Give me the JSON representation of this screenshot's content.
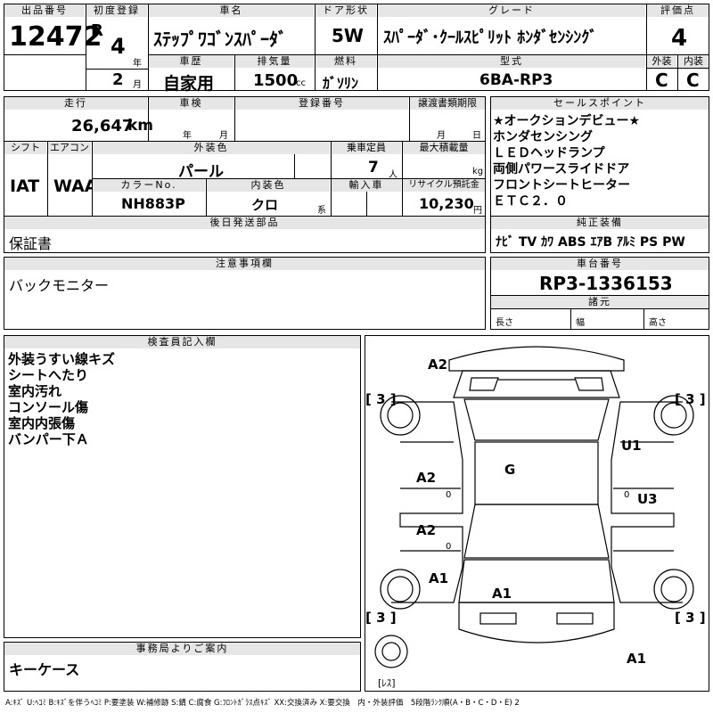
{
  "top": {
    "lot_label": "出品番号",
    "lot_number": "12472",
    "first_reg_label": "初度登録",
    "era": "R",
    "year": "4",
    "year_unit": "年",
    "month": "2",
    "month_unit": "月",
    "name_label": "車名",
    "car_name": "ｽﾃｯﾌﾟﾜｺﾞﾝｽﾊﾟｰﾀﾞ",
    "door_label": "ドア形状",
    "door_value": "5W",
    "grade_label": "グレード",
    "grade_value": "ｽﾊﾟｰﾀﾞ･ｸｰﾙｽﾋﾟﾘｯﾄ ﾎﾝﾀﾞｾﾝｼﾝｸﾞ",
    "score_label": "評価点",
    "score_value": "4",
    "history_label": "車歴",
    "history_value": "自家用",
    "displacement_label": "排気量",
    "displacement_value": "1500",
    "displacement_unit": "cc",
    "fuel_label": "燃料",
    "fuel_value": "ｶﾞｿﾘﾝ",
    "model_label": "型式",
    "model_value": "6BA-RP3",
    "exterior_label": "外装",
    "exterior_value": "C",
    "interior_label": "内装",
    "interior_value": "C"
  },
  "mid": {
    "mileage_label": "走行",
    "mileage_value": "26,647",
    "mileage_unit": "km",
    "inspection_label": "車検",
    "inspection_year_unit": "年",
    "inspection_month_unit": "月",
    "reg_label": "登録番号",
    "transfer_label": "譲渡書類期限",
    "transfer_month_unit": "月",
    "transfer_day_unit": "日",
    "shift_label": "シフト",
    "shift_value": "IAT",
    "aircon_label": "エアコン",
    "aircon_value": "WAA",
    "color_label": "外装色",
    "color_value": "パール",
    "capacity_label": "乗車定員",
    "capacity_value": "7",
    "capacity_unit": "人",
    "load_label": "最大積載量",
    "load_unit": "kg",
    "color_no_label": "カラーNo.",
    "color_no_value": "NH883P",
    "int_color_label": "内装色",
    "int_color_value": "クロ",
    "int_color_unit": "系",
    "import_label": "輸入車",
    "recycle_label": "リサイクル預託金",
    "recycle_value": "10,230",
    "recycle_unit": "円",
    "later_label": "後日発送部品",
    "later_value": "保証書"
  },
  "sales": {
    "label": "セールスポイント",
    "lines": [
      "★オークションデビュー★",
      "ホンダセンシング",
      "ＬＥＤヘッドランプ",
      "両側パワースライドドア",
      "フロントシートヒーター",
      "ＥＴＣ２．０"
    ],
    "equip_label": "純正装備",
    "equip_value": "ﾅﾋﾞ TV ｶﾜ ABS ｴｱB ｱﾙﾐ PS PW"
  },
  "notes": {
    "label": "注意事項欄",
    "value": "バックモニター"
  },
  "chassis": {
    "label": "車台番号",
    "value": "RP3-1336153",
    "spec_label": "諸元",
    "length_label": "長さ",
    "width_label": "幅",
    "height_label": "高さ"
  },
  "inspector": {
    "label": "検査員記入欄",
    "lines": [
      "外装うすい線キズ",
      "シートへたり",
      "室内汚れ",
      "コンソール傷",
      "室内内張傷",
      "バンパー下Ａ"
    ]
  },
  "office": {
    "label": "事務局よりご案内",
    "value": "キーケース"
  },
  "diagram": {
    "marks": {
      "a2_top": "A2",
      "u1": "U1",
      "g": "G",
      "a2_left1": "A2",
      "a2_left2": "A2",
      "u3": "U3",
      "a1_left": "A1",
      "a1_center": "A1",
      "a1_bottom": "A1"
    },
    "tires": {
      "tl": "[ 3 ]",
      "tr": "[ 3 ]",
      "bl": "[ 3 ]",
      "br": "[ 3 ]"
    },
    "zero_left1": "0",
    "zero_left2": "0",
    "zero_right": "0",
    "spare": "[ﾚｽ]"
  },
  "legend": "A:ｷｽﾞ U:ﾍｺﾐ B:ｷｽﾞを伴うﾍｺﾐ P:要塗装 W:補修跡 S:錆 C:腐食 G:ﾌﾛﾝﾄｶﾞﾗｽ点ｷｽﾞ XX:交換済み X:要交換　内・外装評価　5段階ﾗﾝｸ順(A・B・C・D・E) 2"
}
